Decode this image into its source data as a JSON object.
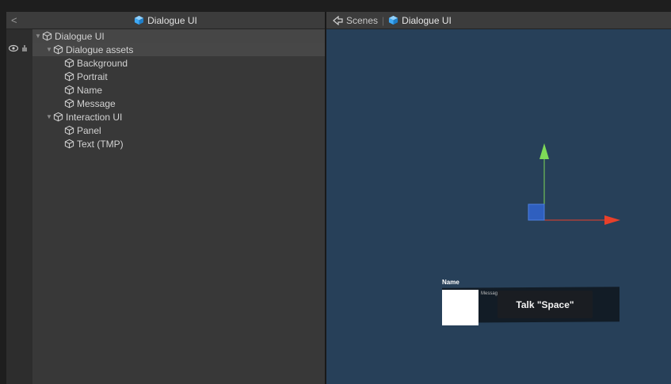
{
  "hierarchy": {
    "back_glyph": "<",
    "title": "Dialogue UI",
    "items": [
      {
        "label": "Dialogue UI",
        "depth": 0,
        "arrow": "▼"
      },
      {
        "label": "Dialogue assets",
        "depth": 1,
        "arrow": "▼"
      },
      {
        "label": "Background",
        "depth": 2,
        "arrow": ""
      },
      {
        "label": "Portrait",
        "depth": 2,
        "arrow": ""
      },
      {
        "label": "Name",
        "depth": 2,
        "arrow": ""
      },
      {
        "label": "Message",
        "depth": 2,
        "arrow": ""
      },
      {
        "label": "Interaction UI",
        "depth": 1,
        "arrow": "▼"
      },
      {
        "label": "Panel",
        "depth": 2,
        "arrow": ""
      },
      {
        "label": "Text (TMP)",
        "depth": 2,
        "arrow": ""
      }
    ]
  },
  "scene": {
    "breadcrumb": {
      "scenes_label": "Scenes",
      "separator": "|",
      "prefab_label": "Dialogue UI"
    },
    "dialogue": {
      "name_text": "Name",
      "message_text": "Message",
      "talk_text": "Talk \"Space\""
    }
  },
  "colors": {
    "scene_bg": "#274059",
    "panel_bg": "#383838",
    "prefab_icon": "#3fa9f5",
    "gizmo_y": "#7ed957",
    "gizmo_x": "#e8402a",
    "gizmo_center": "#2f5fbf"
  },
  "icons": {
    "prefab": "prefab-cube-icon",
    "gameobject": "gameobject-cube-icon",
    "scenes": "scenes-icon",
    "visibility": "eye-icon",
    "pickability": "hand-icon"
  }
}
